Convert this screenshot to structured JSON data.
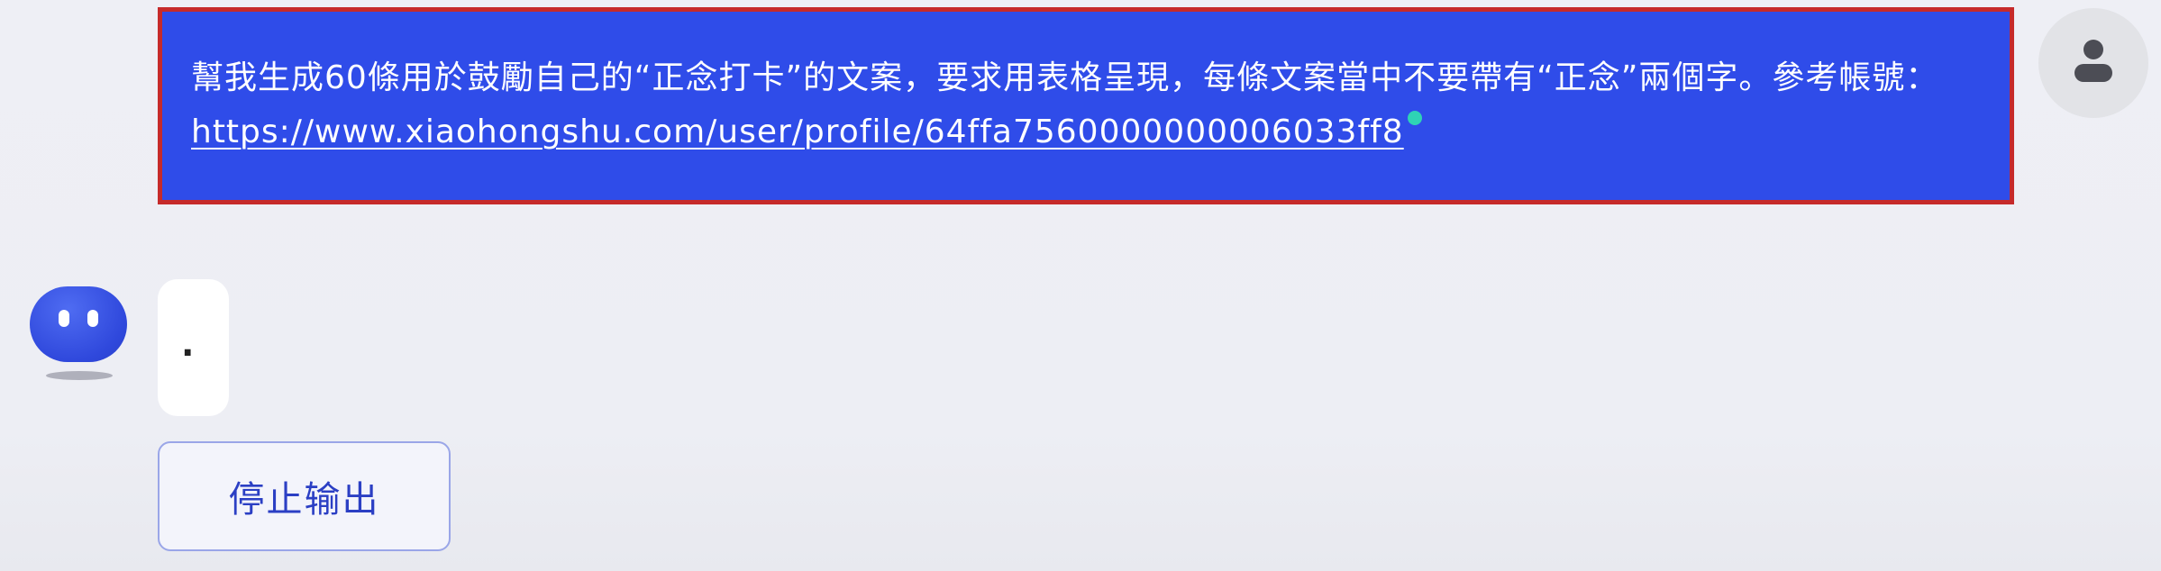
{
  "user_message": {
    "text": "幫我生成60條用於鼓勵自己的“正念打卡”的文案，要求用表格呈現，每條文案當中不要帶有“正念”兩個字。參考帳號：",
    "link": "https://www.xiaohongshu.com/user/profile/64ffa7560000000006033ff8"
  },
  "assistant_message": {
    "text": "."
  },
  "controls": {
    "stop_label": "停止输出"
  },
  "colors": {
    "user_bubble": "#2f4ce9",
    "highlight_border": "#c62a2a",
    "typing_indicator": "#2fd3b5",
    "bot_avatar": "#2f48dc",
    "stop_button_text": "#2b3fc4"
  },
  "icons": {
    "user_avatar": "user-silhouette-icon",
    "bot_avatar": "bot-face-icon"
  }
}
